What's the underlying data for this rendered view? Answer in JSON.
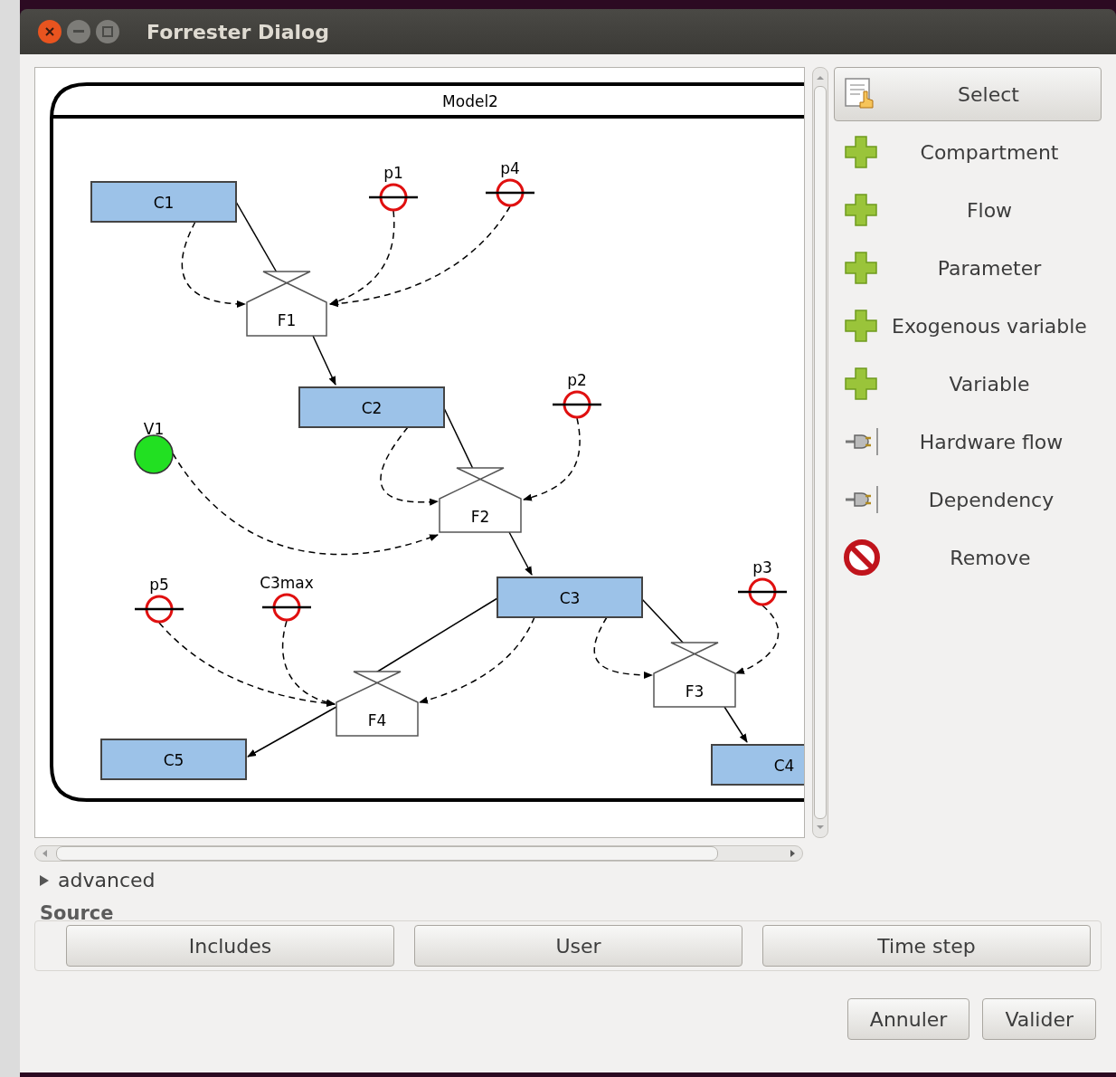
{
  "window": {
    "title": "Forrester Dialog"
  },
  "diagram": {
    "model_title": "Model2",
    "compartments": [
      {
        "label": "C1"
      },
      {
        "label": "C2"
      },
      {
        "label": "C3"
      },
      {
        "label": "C5"
      },
      {
        "label": "C4"
      }
    ],
    "flows": [
      {
        "label": "F1"
      },
      {
        "label": "F2"
      },
      {
        "label": "F3"
      },
      {
        "label": "F4"
      }
    ],
    "parameters": [
      {
        "label": "p1"
      },
      {
        "label": "p4"
      },
      {
        "label": "p2"
      },
      {
        "label": "p3"
      },
      {
        "label": "p5"
      },
      {
        "label": "C3max"
      }
    ],
    "variables": [
      {
        "label": "V1"
      }
    ]
  },
  "tools": [
    {
      "kind": "select",
      "label": "Select",
      "selected": true
    },
    {
      "kind": "add",
      "label": "Compartment",
      "selected": false
    },
    {
      "kind": "add",
      "label": "Flow",
      "selected": false
    },
    {
      "kind": "add",
      "label": "Parameter",
      "selected": false
    },
    {
      "kind": "add",
      "label": "Exogenous variable",
      "selected": false
    },
    {
      "kind": "add",
      "label": "Variable",
      "selected": false
    },
    {
      "kind": "connector",
      "label": "Hardware flow",
      "selected": false
    },
    {
      "kind": "connector",
      "label": "Dependency",
      "selected": false
    },
    {
      "kind": "remove",
      "label": "Remove",
      "selected": false
    }
  ],
  "advanced": {
    "label": "advanced",
    "expanded": false
  },
  "source": {
    "title": "Source",
    "buttons": [
      "Includes",
      "User",
      "Time step"
    ]
  },
  "buttons": [
    "Annuler",
    "Valider"
  ]
}
